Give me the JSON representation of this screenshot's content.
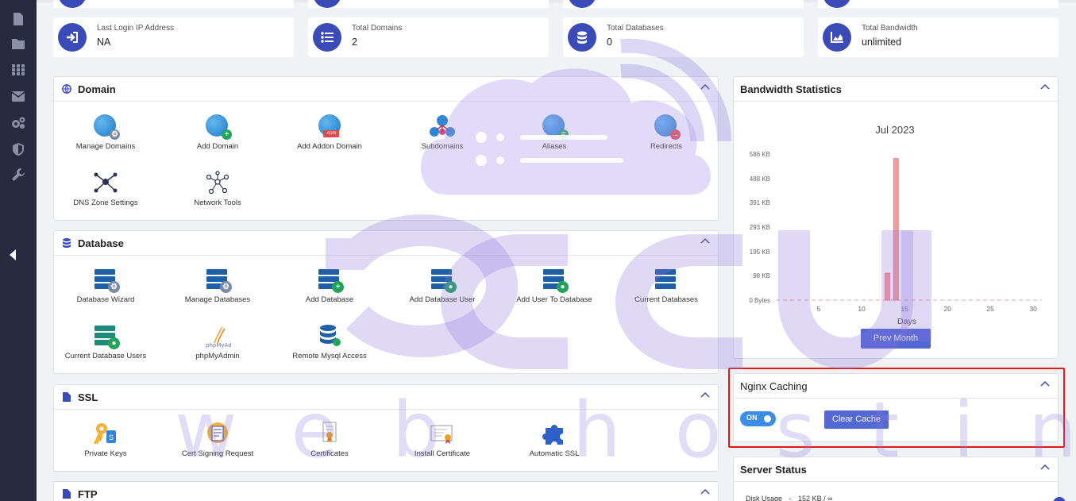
{
  "sidebar": {
    "icons": [
      "file-icon",
      "folder-icon",
      "grid-icon",
      "mail-icon",
      "gears-icon",
      "shield-icon",
      "wrench-icon"
    ],
    "collapse_icon": "caret-left-icon"
  },
  "stats": [
    {
      "label": "Last Login IP Address",
      "value": "NA",
      "icon": "login-icon"
    },
    {
      "label": "Total Domains",
      "value": "2",
      "icon": "list-icon"
    },
    {
      "label": "Total Databases",
      "value": "0",
      "icon": "database-icon"
    },
    {
      "label": "Total Bandwidth",
      "value": "unlimited",
      "icon": "area-chart-icon"
    }
  ],
  "domain": {
    "title": "Domain",
    "tools": [
      "Manage Domains",
      "Add Domain",
      "Add Addon Domain",
      "Subdomains",
      "Aliases",
      "Redirects",
      "DNS Zone Settings",
      "Network Tools"
    ],
    "addon_badge": ".com"
  },
  "database": {
    "title": "Database",
    "tools": [
      "Database Wizard",
      "Manage Databases",
      "Add Database",
      "Add Database User",
      "Add User To Database",
      "Current Databases",
      "Current Database Users",
      "phpMyAdmin",
      "Remote Mysql Access"
    ],
    "pma_logo": "phpMyAdmin"
  },
  "ssl": {
    "title": "SSL",
    "tools": [
      "Private Keys",
      "Cert Signing Request",
      "Certificates",
      "Install Certificate",
      "Automatic SSL"
    ]
  },
  "ftp": {
    "title": "FTP"
  },
  "bandwidth": {
    "title": "Bandwidth Statistics",
    "prev_month": "Prev Month"
  },
  "nginx": {
    "title": "Nginx Caching",
    "toggle_label": "ON",
    "toggle_on": true,
    "clear_cache": "Clear Cache"
  },
  "server_status": {
    "title": "Server Status",
    "disk_label": "Disk Usage",
    "disk_sep": "-",
    "disk_value": "152 KB / ∞"
  },
  "watermark": {
    "word1": "acc",
    "word2": "web hosting"
  },
  "colors": {
    "accent": "#3a4ab7",
    "button": "#5468d4",
    "bar": "#f79c9c",
    "highlight": "#e01919",
    "sidebar": "#262b3f"
  },
  "chart_data": {
    "type": "bar",
    "title": "Jul 2023",
    "xlabel": "Days",
    "ylabel": "",
    "x_ticks": [
      5,
      10,
      15,
      20,
      25,
      30
    ],
    "y_ticks": [
      "0 Bytes",
      "98 KB",
      "195 KB",
      "293 KB",
      "391 KB",
      "488 KB",
      "586 KB"
    ],
    "y_tick_values_kb": [
      0,
      98,
      195,
      293,
      391,
      488,
      586
    ],
    "xlim": [
      0,
      31
    ],
    "ylim_kb": [
      0,
      586
    ],
    "x": [
      13,
      14
    ],
    "values_kb": [
      108,
      568
    ],
    "zero_line": "dashed"
  }
}
